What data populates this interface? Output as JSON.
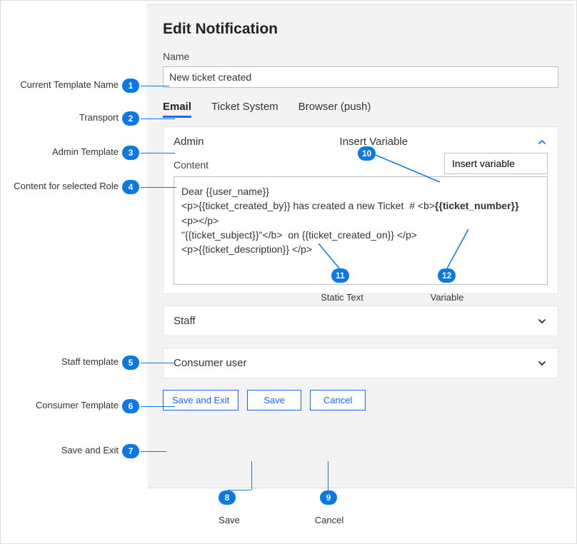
{
  "header": {
    "title": "Edit Notification"
  },
  "form": {
    "name_label": "Name",
    "name_value": "New ticket created"
  },
  "tabs": [
    {
      "label": "Email",
      "active": true
    },
    {
      "label": "Ticket System",
      "active": false
    },
    {
      "label": "Browser (push)",
      "active": false
    }
  ],
  "roles": [
    {
      "title": "Admin",
      "expanded": true,
      "insert_label": "Insert Variable",
      "insert_button": "Insert variable",
      "content_label": "Content",
      "content": {
        "l1a": "Dear ",
        "v_user": "{{user_name}}",
        "l2a": "<p>",
        "v_created_by": "{{ticket_created_by}}",
        "l2b": " has created a new Ticket  # <b>",
        "v_number": "{{ticket_number}}",
        "l3": "<p></p>",
        "l4a": "\"",
        "v_subject": "{{ticket_subject}}",
        "l4b": "\"</b>  on ",
        "v_created_on": "{{ticket_created_on}}",
        "l4c": " </p>",
        "l5a": "<p>",
        "v_desc": "{{ticket_description}}",
        "l5b": " </p>"
      }
    },
    {
      "title": "Staff",
      "expanded": false
    },
    {
      "title": "Consumer user",
      "expanded": false
    }
  ],
  "buttons": {
    "save_exit": "Save and Exit",
    "save": "Save",
    "cancel": "Cancel"
  },
  "annotations": [
    {
      "n": "1",
      "label": "Current Template Name"
    },
    {
      "n": "2",
      "label": "Transport"
    },
    {
      "n": "3",
      "label": "Admin Template"
    },
    {
      "n": "4",
      "label": "Content for selected Role"
    },
    {
      "n": "5",
      "label": "Staff template"
    },
    {
      "n": "6",
      "label": "Consumer Template"
    },
    {
      "n": "7",
      "label": "Save and Exit"
    },
    {
      "n": "8",
      "label": "Save"
    },
    {
      "n": "9",
      "label": "Cancel"
    },
    {
      "n": "10",
      "label": "Insert Variable"
    },
    {
      "n": "11",
      "label": "Static Text"
    },
    {
      "n": "12",
      "label": "Variable"
    }
  ]
}
